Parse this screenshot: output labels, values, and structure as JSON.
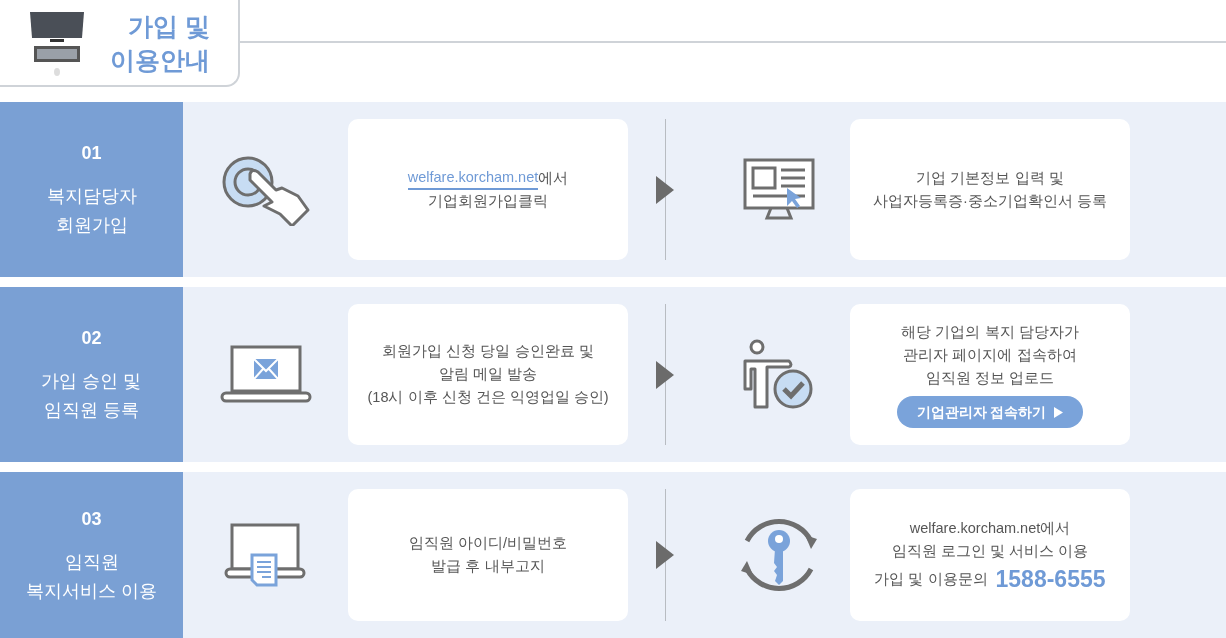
{
  "header": {
    "title_lines": [
      "가입 및",
      "이용안내"
    ]
  },
  "steps": [
    {
      "number": "01",
      "title_lines": [
        "복지담당자",
        "회원가입"
      ],
      "left_icon": {
        "kind": "touch"
      },
      "left_card": {
        "link": "welfare.korcham.net",
        "link_suffix": "에서",
        "lines": [
          "기업회원가입클릭"
        ]
      },
      "right_icon": {
        "kind": "monitor"
      },
      "right_card": {
        "lines": [
          "기업 기본정보 입력 및",
          "사업자등록증·중소기업확인서 등록"
        ]
      }
    },
    {
      "number": "02",
      "title_lines": [
        "가입 승인 및",
        "임직원 등록"
      ],
      "left_icon": {
        "kind": "laptop-mail"
      },
      "left_card": {
        "lines": [
          "회원가입 신청 당일 승인완료 및",
          "알림 메일 발송",
          "(18시 이후 신청 건은 익영업일 승인)"
        ]
      },
      "right_icon": {
        "kind": "person-check"
      },
      "right_card": {
        "lines": [
          "해당 기업의 복지 담당자가",
          "관리자 페이지에 접속하여",
          "임직원 정보 업로드"
        ],
        "button": "기업관리자 접속하기"
      }
    },
    {
      "number": "03",
      "title_lines": [
        "임직원",
        "복지서비스 이용"
      ],
      "left_icon": {
        "kind": "laptop-document"
      },
      "left_card": {
        "lines": [
          "임직원 아이디/비밀번호",
          "발급 후 내부고지"
        ]
      },
      "right_icon": {
        "kind": "key-cycle"
      },
      "right_card": {
        "lines": [
          "welfare.korcham.net에서",
          "임직원 로그인 및 서비스 이용"
        ],
        "contact": {
          "label": "가입 및 이용문의",
          "number": "1588-6555"
        }
      }
    }
  ]
}
